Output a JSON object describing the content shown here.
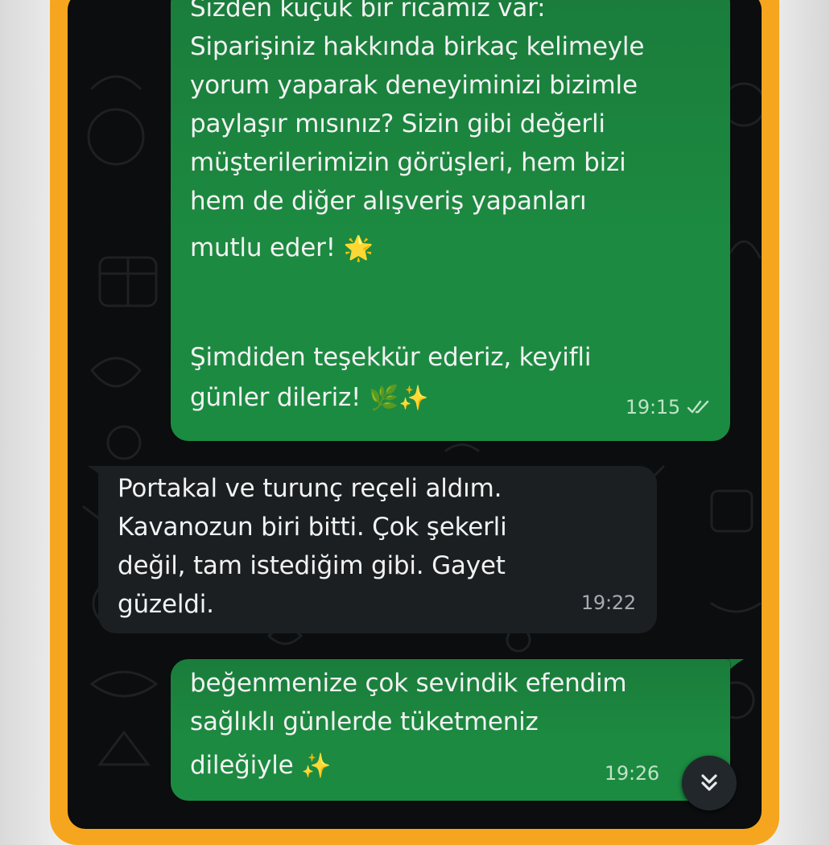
{
  "messages": [
    {
      "direction": "outgoing",
      "lines": [
        "Sizden küçük bir ricamız var:",
        "Siparişiniz hakkında birkaç kelimeyle",
        "yorum yaparak deneyiminizi bizimle",
        "paylaşır mısınız? Sizin gibi değerli",
        "müşterilerimizin görüşleri, hem bizi",
        "hem de diğer alışveriş yapanları",
        "mutlu eder!"
      ],
      "emoji_1": "🌟",
      "lines_2": [
        "Şimdiden teşekkür ederiz, keyifli",
        "günler dileriz!"
      ],
      "emoji_2": "🌿✨",
      "time": "19:15",
      "status_icon": "double-check-read-icon"
    },
    {
      "direction": "incoming",
      "lines": [
        "Portakal ve turunç reçeli aldım.",
        "Kavanozun biri bitti. Çok şekerli",
        "değil, tam istediğim gibi. Gayet",
        "güzeldi."
      ],
      "time": "19:22"
    },
    {
      "direction": "outgoing",
      "lines": [
        "beğenmenize çok sevindik efendim",
        "sağlıklı günlerde tüketmeniz",
        "dileğiyle"
      ],
      "emoji_1": "✨",
      "time": "19:26"
    }
  ],
  "scroll_button": {
    "icon": "double-chevron-down-icon"
  },
  "colors": {
    "frame": "#f6a61e",
    "chat_background": "#0b0d0e",
    "outgoing_bubble": "#1c8a40",
    "incoming_bubble": "#1b1f22",
    "text": "#f2f2f2"
  }
}
